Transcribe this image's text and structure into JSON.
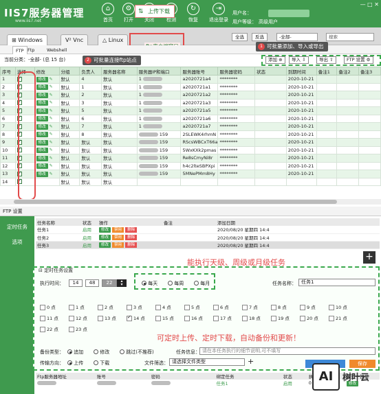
{
  "app": {
    "logo": "IIS7服务器管理",
    "url": "www.iis7.net"
  },
  "nav": [
    {
      "label": "首页",
      "icon": "⌂"
    },
    {
      "label": "打开",
      "icon": "⚙"
    },
    {
      "label": "关闭",
      "icon": "⏻"
    },
    {
      "label": "检测",
      "icon": "✓"
    },
    {
      "label": "恢复",
      "icon": "↻"
    },
    {
      "label": "退出登录",
      "icon": "⇥"
    }
  ],
  "user": {
    "name_label": "用户名：",
    "level_label": "用户等级：",
    "level_value": "高级用户"
  },
  "tabs": {
    "windows": "Windows",
    "vnc": "Vnc",
    "linux": "Linux",
    "upload": "上传下载",
    "ftp_client": "ftp客户端窗口"
  },
  "top_buttons": {
    "select_all": "全选",
    "invert": "反选",
    "all_option": "-全部-",
    "search_placeholder": "搜索"
  },
  "subtabs": {
    "ftp": "FTP",
    "ftp2": "Ftp",
    "webshell": "Webshell"
  },
  "toolbar": {
    "category": "当前分类：-全部- (总 15 台)",
    "add": "添加",
    "import": "导入",
    "export": "导出",
    "ftp_settings": "FTP 设置"
  },
  "callouts": {
    "c1_num": "1",
    "c1": "可批量添加、导入或导出",
    "c2_num": "2",
    "c2": "可批量连接ftp站点"
  },
  "table": {
    "headers": [
      "序号",
      "选择",
      "修改",
      "分组",
      "负责人",
      "服务器名称",
      "服务器IP和端口",
      "服务器账号",
      "服务器密码",
      "状态",
      "到期时间",
      "备注1",
      "备注2",
      "备注3"
    ],
    "edit_label": "修改",
    "rows": [
      {
        "no": "1",
        "group": "默认",
        "owner": "4",
        "sname": "默认",
        "ip": "1",
        "acc": "a2020721a4",
        "pwd": "********",
        "exp": "2020-10-21"
      },
      {
        "no": "2",
        "group": "默认",
        "owner": "1",
        "sname": "默认",
        "ip": "1",
        "acc": "a2020721a1",
        "pwd": "********",
        "exp": "2020-10-21"
      },
      {
        "no": "3",
        "group": "默认",
        "owner": "2",
        "sname": "默认",
        "ip": "1",
        "acc": "a2020721a2",
        "pwd": "********",
        "exp": "2020-10-21"
      },
      {
        "no": "4",
        "group": "默认",
        "owner": "3",
        "sname": "默认",
        "ip": "1",
        "acc": "a2020721a3",
        "pwd": "********",
        "exp": "2020-10-21"
      },
      {
        "no": "5",
        "group": "默认",
        "owner": "5",
        "sname": "默认",
        "ip": "1",
        "acc": "a2020721a5",
        "pwd": "********",
        "exp": "2020-10-21"
      },
      {
        "no": "6",
        "group": "默认",
        "owner": "6",
        "sname": "默认",
        "ip": "1",
        "acc": "a2020721a6",
        "pwd": "********",
        "exp": "2020-10-21"
      },
      {
        "no": "7",
        "group": "默认",
        "owner": "7",
        "sname": "默认",
        "ip": "1",
        "acc": "a2020721a7",
        "pwd": "********",
        "exp": "2020-10-21"
      },
      {
        "no": "8",
        "group": "默认",
        "owner": "8",
        "sname": "默认",
        "ip": "159",
        "acc": "2SLEWK4rhmN",
        "pwd": "********",
        "exp": "2020-10-21"
      },
      {
        "no": "9",
        "group": "默认",
        "owner": "默认",
        "sname": "默认",
        "ip": "159",
        "acc": "RScsWBCxT66a",
        "pwd": "********",
        "exp": "2020-10-21"
      },
      {
        "no": "10",
        "group": "默认",
        "owner": "默认",
        "sname": "默认",
        "ip": "159",
        "acc": "5WxKXk2pmas",
        "pwd": "********",
        "exp": "2020-10-21"
      },
      {
        "no": "11",
        "group": "默认",
        "owner": "默认",
        "sname": "默认",
        "ip": "159",
        "acc": "Re8sCmyNi8r",
        "pwd": "********",
        "exp": "2020-10-21"
      },
      {
        "no": "12",
        "group": "默认",
        "owner": "默认",
        "sname": "默认",
        "ip": "159",
        "acc": "h4c2lteSBPXpi",
        "pwd": "********",
        "exp": "2020-10-21"
      },
      {
        "no": "13",
        "group": "默认",
        "owner": "默认",
        "sname": "默认",
        "ip": "159",
        "acc": "5MNePMm8Hy",
        "pwd": "********",
        "exp": "2020-10-21"
      },
      {
        "no": "14",
        "group": "默认",
        "owner": "默认",
        "sname": "默认",
        "ip": "",
        "acc": "",
        "pwd": "",
        "exp": ""
      }
    ]
  },
  "ftp_settings": {
    "title": "FTP 设置",
    "nav": [
      "定时任务",
      "选项"
    ],
    "task_headers": [
      "任务名称",
      "状态",
      "操作",
      "备注",
      "添加日期"
    ],
    "tasks": [
      {
        "name": "任务1",
        "status": "启用",
        "date": "2020/08/20 星期四 14:4"
      },
      {
        "name": "任务2",
        "status": "启用",
        "date": "2020/08/20 星期四 14:4"
      },
      {
        "name": "任务3",
        "status": "启用",
        "date": "2020/08/20 星期四 14:4"
      }
    ],
    "ops": {
      "edit": "修改",
      "disable": "禁用",
      "delete": "删除"
    },
    "plus": "+",
    "period_note": "能执行天级、周级或月级任务",
    "sched_title": "定时任务设置",
    "exec_time_label": "执行时间：",
    "time": {
      "h": "14",
      "m": "48",
      "s": "22"
    },
    "period": {
      "daily": "每天",
      "weekly": "每周",
      "monthly": "每月"
    },
    "task_name_label": "任务名称：",
    "task_name_value": "任务1",
    "hours": [
      "0 点",
      "1 点",
      "2 点",
      "3 点",
      "4 点",
      "5 点",
      "6 点",
      "7 点",
      "8 点",
      "9 点",
      "10 点",
      "11 点",
      "12 点",
      "13 点",
      "14 点",
      "15 点",
      "16 点",
      "17 点",
      "18 点",
      "19 点",
      "20 点",
      "21 点",
      "22 点",
      "23 点"
    ],
    "checked_hour": "14 点",
    "big_note": "可定时上传、定时下载，自动备份和更新！",
    "backup_label": "备份类型：",
    "backup": {
      "add": "追加",
      "modify": "修改",
      "skip": "跳过(不推荐)"
    },
    "task_info_label": "任务信息：",
    "task_info_placeholder": "请在本任务执行的细节说明,可不填写",
    "direction_label": "传输方向：",
    "direction": {
      "up": "上传",
      "down": "下载"
    },
    "file_filter_label": "文件筛选：",
    "file_filter_value": "请选择文件类型",
    "save": "保存",
    "bottom_headers": [
      "Ftp服务器地址",
      "账号",
      "密码",
      "绑定任务",
      "状态",
      "执行次数",
      "最近一操作"
    ],
    "bottom_row": {
      "task": "任务1",
      "status": "启用",
      "count": "0",
      "op": "修改"
    }
  },
  "watermark": {
    "text": "树叶云",
    "ai": "AI"
  }
}
